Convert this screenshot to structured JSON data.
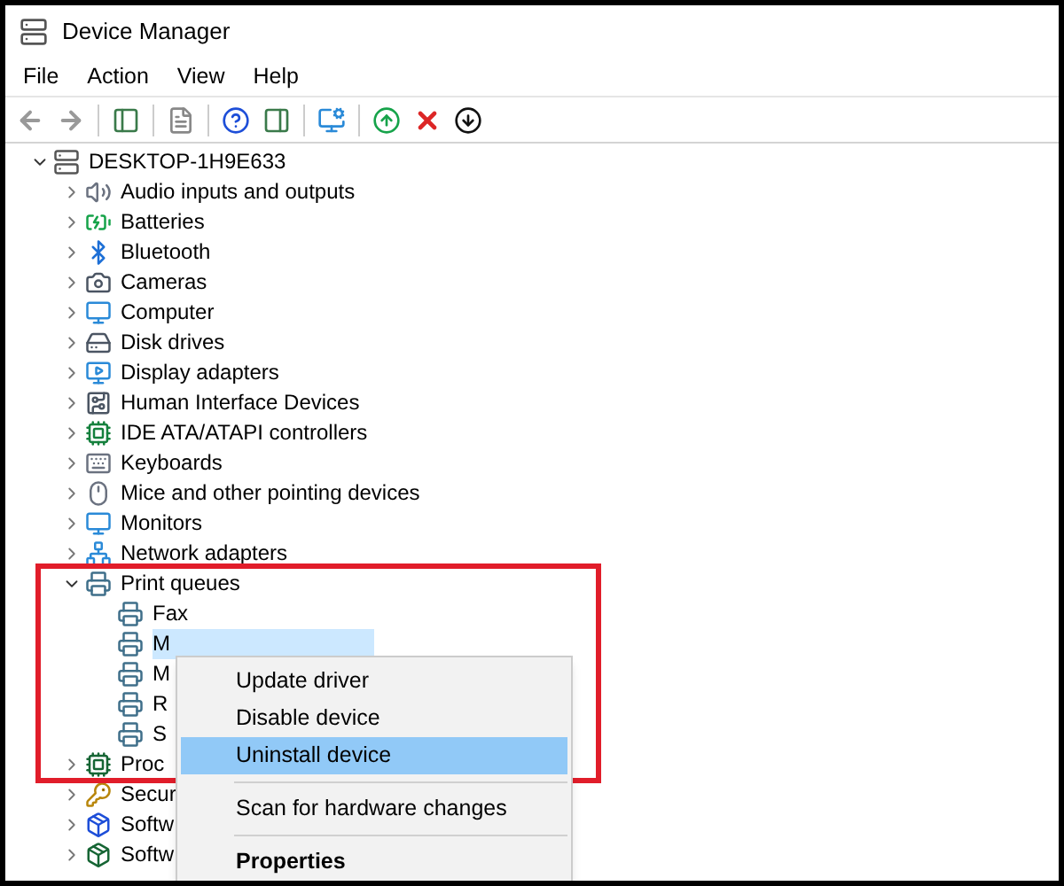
{
  "window": {
    "title": "Device Manager"
  },
  "menu_bar": [
    "File",
    "Action",
    "View",
    "Help"
  ],
  "tree": {
    "label": "DESKTOP-1H9E633",
    "expanded": true,
    "selected": false,
    "children": [
      {
        "label": "Audio inputs and outputs",
        "expanded": false,
        "selected": false
      },
      {
        "label": "Batteries",
        "expanded": false,
        "selected": false
      },
      {
        "label": "Bluetooth",
        "expanded": false,
        "selected": false
      },
      {
        "label": "Cameras",
        "expanded": false,
        "selected": false
      },
      {
        "label": "Computer",
        "expanded": false,
        "selected": false
      },
      {
        "label": "Disk drives",
        "expanded": false,
        "selected": false
      },
      {
        "label": "Display adapters",
        "expanded": false,
        "selected": false
      },
      {
        "label": "Human Interface Devices",
        "expanded": false,
        "selected": false
      },
      {
        "label": "IDE ATA/ATAPI controllers",
        "expanded": false,
        "selected": false
      },
      {
        "label": "Keyboards",
        "expanded": false,
        "selected": false
      },
      {
        "label": "Mice and other pointing devices",
        "expanded": false,
        "selected": false
      },
      {
        "label": "Monitors",
        "expanded": false,
        "selected": false
      },
      {
        "label": "Network adapters",
        "expanded": false,
        "selected": false
      },
      {
        "label": "Print queues",
        "expanded": true,
        "selected": false,
        "children": [
          {
            "label": "Fax",
            "selected": false
          },
          {
            "label": "M",
            "selected": true
          },
          {
            "label": "M",
            "selected": false
          },
          {
            "label": "R",
            "selected": false
          },
          {
            "label": "S",
            "selected": false
          }
        ]
      },
      {
        "label": "Proc",
        "expanded": false,
        "selected": false
      },
      {
        "label": "Secur",
        "expanded": false,
        "selected": false
      },
      {
        "label": "Softw",
        "expanded": false,
        "selected": false
      },
      {
        "label": "Softw",
        "expanded": false,
        "selected": false
      }
    ]
  },
  "context_menu": {
    "items": [
      {
        "kind": "item",
        "label": "Update driver",
        "selected": false,
        "bold": false
      },
      {
        "kind": "item",
        "label": "Disable device",
        "selected": false,
        "bold": false
      },
      {
        "kind": "item",
        "label": "Uninstall device",
        "selected": true,
        "bold": false
      },
      {
        "kind": "separator"
      },
      {
        "kind": "item",
        "label": "Scan for hardware changes",
        "selected": false,
        "bold": false
      },
      {
        "kind": "separator"
      },
      {
        "kind": "item",
        "label": "Properties",
        "selected": false,
        "bold": true
      }
    ]
  }
}
